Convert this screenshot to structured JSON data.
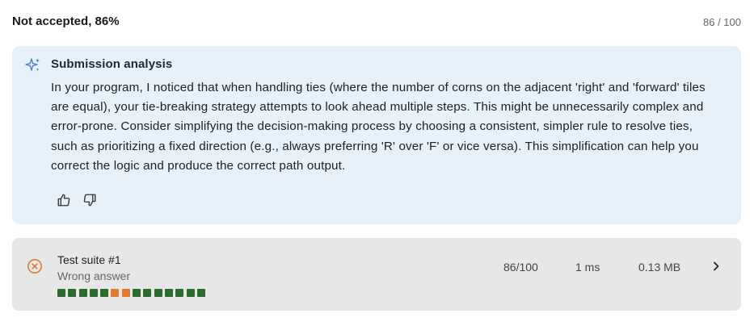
{
  "header": {
    "status": "Not accepted, 86%",
    "score": "86 / 100"
  },
  "analysis": {
    "icon": "sparkle-icon",
    "title": "Submission analysis",
    "body": "In your program, I noticed that when handling ties (where the number of corns on the adjacent 'right' and 'forward' tiles are equal), your tie-breaking strategy attempts to look ahead multiple steps. This might be unnecessarily complex and error-prone. Consider simplifying the decision-making process by choosing a consistent, simpler rule to resolve ties, such as prioritizing a fixed direction (e.g., always preferring 'R' over 'F' or vice versa). This simplification can help you correct the logic and produce the correct path output.",
    "feedback": [
      "thumbs-up-icon",
      "thumbs-down-icon"
    ]
  },
  "test_suite": {
    "name": "Test suite #1",
    "status": "Wrong answer",
    "score": "86/100",
    "time": "1 ms",
    "memory": "0.13 MB",
    "cases": [
      "pass",
      "pass",
      "pass",
      "pass",
      "pass",
      "fail",
      "fail",
      "pass",
      "pass",
      "pass",
      "pass",
      "pass",
      "pass",
      "pass"
    ]
  },
  "colors": {
    "accent_fail": "#e07a2f",
    "case_pass": "#2e6b2e",
    "case_fail": "#e07a2f",
    "analysis_bg": "#e6f1fa",
    "suite_bg": "#e6e8e8",
    "sparkle": "#4a7fc1"
  }
}
